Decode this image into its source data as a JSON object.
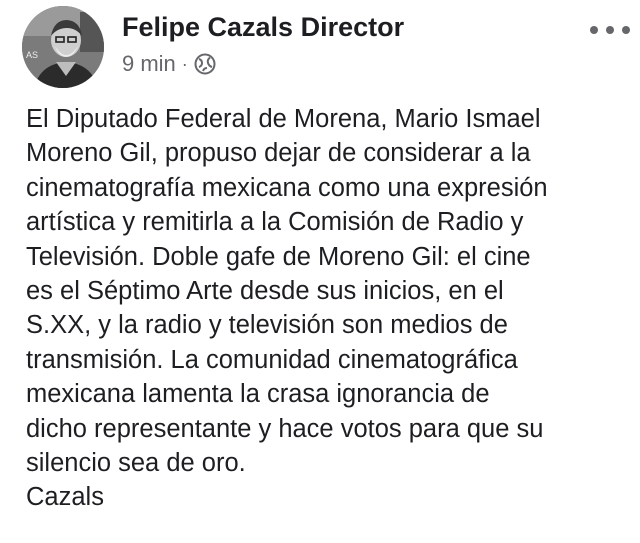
{
  "post": {
    "author": "Felipe Cazals Director",
    "timestamp": "9 min",
    "separator": "·",
    "privacy_icon": "globe-icon",
    "more_icon": "more-options-icon",
    "lines": [
      "El Diputado Federal de Morena, Mario Ismael",
      "Moreno Gil, propuso dejar de considerar a la",
      "cinematografía mexicana como una expresión",
      "artística y remitirla a la Comisión de Radio y",
      "Televisión. Doble gafe de Moreno Gil: el cine",
      "es el Séptimo Arte desde sus inicios, en el",
      "S.XX, y la radio y televisión son medios de",
      "transmisión. La comunidad cinematográfica",
      "mexicana lamenta la crasa ignorancia de",
      "dicho representante y hace votos para que su",
      "silencio sea de oro.",
      "Cazals"
    ]
  },
  "colors": {
    "text": "#1c1e21",
    "secondary": "#65676b",
    "background": "#ffffff"
  }
}
